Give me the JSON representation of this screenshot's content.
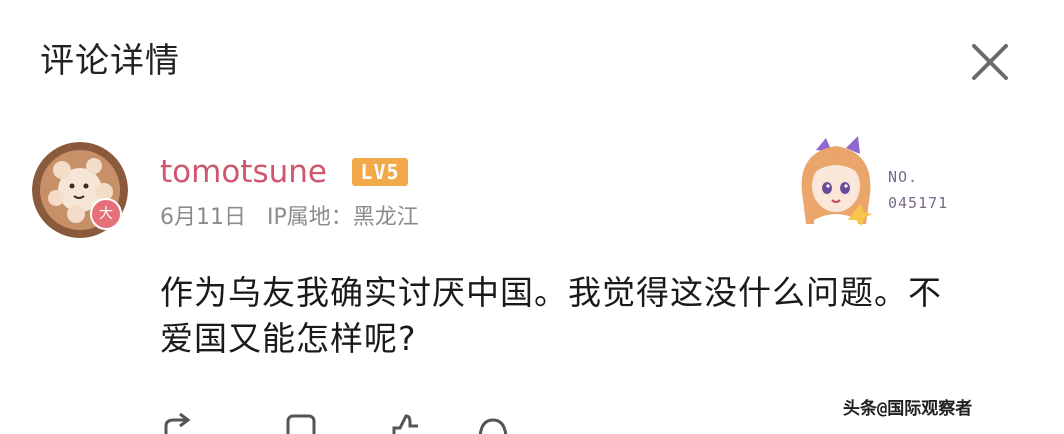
{
  "header": {
    "title": "评论详情",
    "close_icon": "close-icon"
  },
  "comment": {
    "user": {
      "name": "tomotsune",
      "level": "LV5",
      "avatar_badge": "大"
    },
    "meta": {
      "date": "6月11日",
      "ip_location": "IP属地：黑龙江"
    },
    "fan_card": {
      "label": "NO.",
      "number": "045171"
    },
    "text": "作为乌友我确实讨厌中国。我觉得这没什么问题。不爱国又能怎样呢?"
  },
  "actions": {
    "share_icon": "share-icon",
    "reply_icon": "comment-icon",
    "like_icon": "thumbs-up-icon",
    "more_icon": "more-icon"
  },
  "watermark": {
    "text": "头条@国际观察者"
  },
  "colors": {
    "username": "#d0566e",
    "level_badge": "#f2a94a",
    "meta_text": "#8c8c8c",
    "body_text": "#1a1a1a"
  }
}
